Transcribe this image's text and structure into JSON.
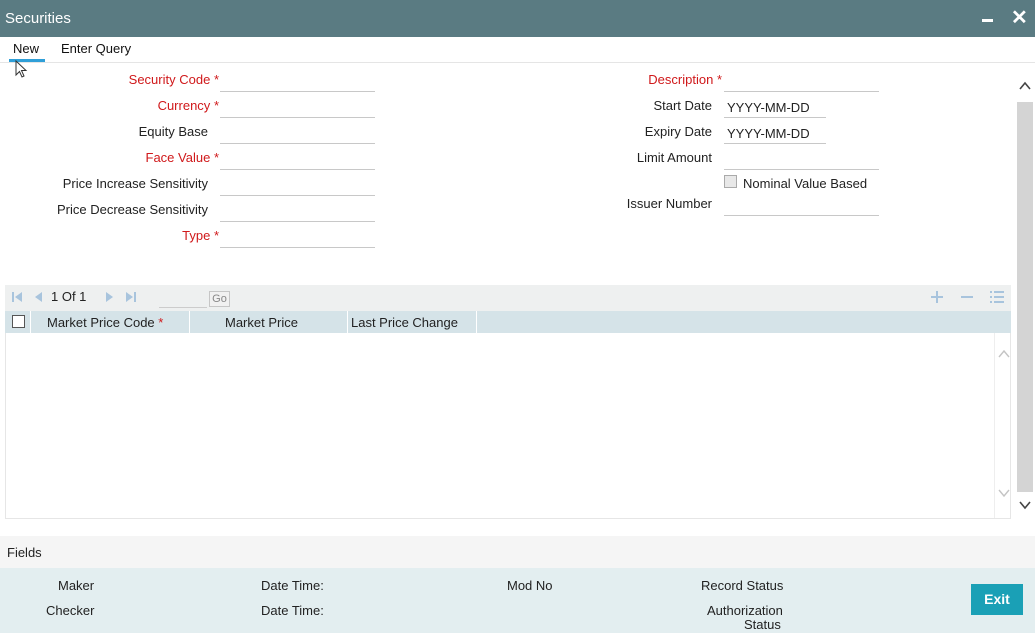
{
  "window": {
    "title": "Securities"
  },
  "menu": {
    "new": "New",
    "enter_query": "Enter Query"
  },
  "form": {
    "security_code": {
      "label": "Security Code",
      "value": ""
    },
    "currency": {
      "label": "Currency",
      "value": ""
    },
    "equity_base": {
      "label": "Equity Base",
      "value": ""
    },
    "face_value": {
      "label": "Face Value",
      "value": ""
    },
    "price_increase_sensitivity": {
      "label": "Price Increase Sensitivity",
      "value": ""
    },
    "price_decrease_sensitivity": {
      "label": "Price Decrease Sensitivity",
      "value": ""
    },
    "type": {
      "label": "Type",
      "value": ""
    },
    "description": {
      "label": "Description",
      "value": ""
    },
    "start_date": {
      "label": "Start Date",
      "placeholder": "YYYY-MM-DD"
    },
    "expiry_date": {
      "label": "Expiry Date",
      "placeholder": "YYYY-MM-DD"
    },
    "limit_amount": {
      "label": "Limit Amount",
      "value": ""
    },
    "nominal_value_based": {
      "label": "Nominal Value Based",
      "checked": false
    },
    "issuer_number": {
      "label": "Issuer Number",
      "value": ""
    },
    "required_marker": "*"
  },
  "grid": {
    "pager_text": "1 Of 1",
    "go_label": "Go",
    "columns": [
      "Market Price Code",
      "Market Price",
      "Last Price Change"
    ],
    "rows": []
  },
  "fields_label": "Fields",
  "footer": {
    "maker": "Maker",
    "checker": "Checker",
    "date_time_1": "Date Time:",
    "date_time_2": "Date Time:",
    "mod_no": "Mod No",
    "record_status": "Record Status",
    "authorization_status_line1": "Authorization",
    "authorization_status_line2": "Status",
    "exit": "Exit"
  },
  "colors": {
    "titlebar": "#5a7b82",
    "required": "#d0191b",
    "accent": "#2f9fd8",
    "exit_button": "#1aa0b6",
    "grid_header": "#d5e3e8",
    "footer": "#e3eef0"
  }
}
